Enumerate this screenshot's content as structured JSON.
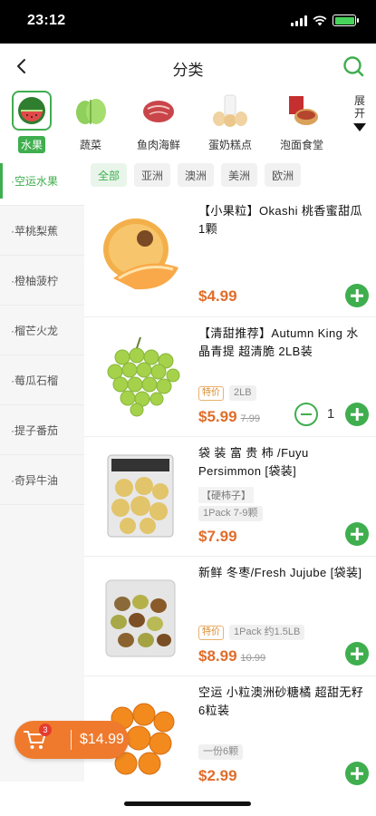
{
  "status_bar": {
    "time": "23:12"
  },
  "header": {
    "title": "分类"
  },
  "categories": {
    "items": [
      {
        "label": "水果",
        "icon": "watermelon-icon",
        "active": true
      },
      {
        "label": "蔬菜",
        "icon": "lettuce-icon",
        "active": false
      },
      {
        "label": "鱼肉海鲜",
        "icon": "meat-icon",
        "active": false
      },
      {
        "label": "蛋奶糕点",
        "icon": "eggs-milk-icon",
        "active": false
      },
      {
        "label": "泡面食堂",
        "icon": "noodle-icon",
        "active": false
      }
    ],
    "expand_label": "展开"
  },
  "sidebar": {
    "items": [
      {
        "label": "·空运水果",
        "active": true
      },
      {
        "label": "·苹桃梨蕉",
        "active": false
      },
      {
        "label": "·橙柚菠柠",
        "active": false
      },
      {
        "label": "·榴芒火龙",
        "active": false
      },
      {
        "label": "·莓瓜石榴",
        "active": false
      },
      {
        "label": "·提子番茄",
        "active": false
      },
      {
        "label": "·奇异牛油",
        "active": false
      }
    ]
  },
  "filters": [
    {
      "label": "全部",
      "active": true
    },
    {
      "label": "亚洲",
      "active": false
    },
    {
      "label": "澳洲",
      "active": false
    },
    {
      "label": "美洲",
      "active": false
    },
    {
      "label": "欧洲",
      "active": false
    }
  ],
  "products": [
    {
      "title": "【小果粒】Okashi 桃香蜜甜瓜 1颗",
      "price": "$4.99",
      "original_price": "",
      "promo_tag": "",
      "spec": "",
      "note": "",
      "quantity": ""
    },
    {
      "title": "【清甜推荐】Autumn King 水晶青提 超清脆 2LB装",
      "price": "$5.99",
      "original_price": "7.99",
      "promo_tag": "特价",
      "spec": "2LB",
      "note": "",
      "quantity": "1"
    },
    {
      "title": "袋 装 富 贵 柿 /Fuyu Persimmon [袋装]",
      "price": "$7.99",
      "original_price": "",
      "promo_tag": "",
      "spec": "1Pack 7-9颗",
      "note": "【硬柿子】",
      "quantity": ""
    },
    {
      "title": "新鲜 冬枣/Fresh Jujube [袋装]",
      "price": "$8.99",
      "original_price": "10.99",
      "promo_tag": "特价",
      "spec": "1Pack 约1.5LB",
      "note": "",
      "quantity": ""
    },
    {
      "title": "空运 小粒澳洲砂糖橘 超甜无籽 6粒装",
      "price": "$2.99",
      "original_price": "",
      "promo_tag": "",
      "spec": "一份6颗",
      "note": "",
      "quantity": ""
    }
  ],
  "cart": {
    "count": "3",
    "total": "$14.99"
  },
  "colors": {
    "accent": "#3fae4e",
    "price": "#e06d2a",
    "cart": "#ef7a2d"
  }
}
